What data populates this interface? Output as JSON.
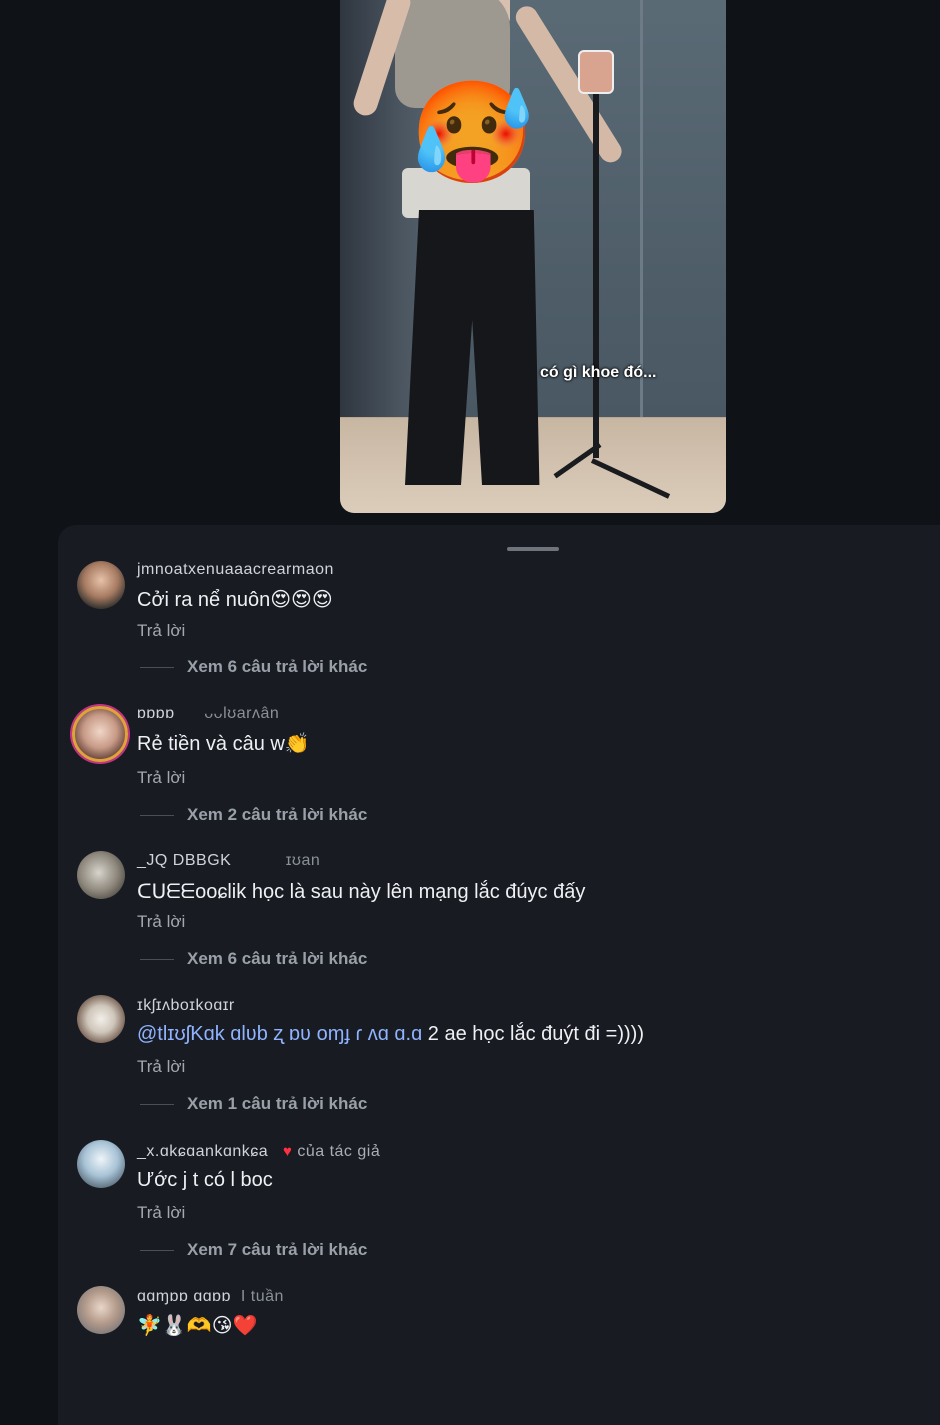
{
  "video": {
    "caption": "có gì khoe đó..."
  },
  "comments": [
    {
      "username": "jmnoatxenuaaacrearmaon",
      "time": "",
      "text": "Cởi ra nể nuôn",
      "text_emojis": "😍😍😍",
      "reply_label": "Trả lời",
      "more_replies": "Xem 6 câu trả lời khác"
    },
    {
      "username": "ɒɒɒɒ",
      "time": "ᴗᴗlʊarʌân",
      "text": "Rẻ tiền và câu w",
      "text_emojis": "👏",
      "reply_label": "Trả lời",
      "more_replies": "Xem 2 câu trả lời khác"
    },
    {
      "username": "_JQ DBBGK",
      "time": "ɪʊan",
      "text_prefix": "ᑕᑌᗴᗴooɕlik",
      "text": " học là sau này lên mạng lắc đúyc đấy",
      "reply_label": "Trả lời",
      "more_replies": "Xem 6 câu trả lời khác"
    },
    {
      "username": "ɪkʃɪʌboɪkoɑɪr",
      "time": "",
      "mention": "@tlɪʊʃKɑk ɑlʋb ʐ ɒʋ oɱɟ ɾ ʌɑ ɑ.ɑ",
      "text": " 2 ae học lắc đuýt đi =))))",
      "reply_label": "Trả lời",
      "more_replies": "Xem 1 câu trả lời khác"
    },
    {
      "username": "_x.ɑkɕɑankɑnkɕa",
      "author_heart": "♥",
      "author_label": "của tác giả",
      "text": "Ước j t có l boc",
      "reply_label": "Trả lời",
      "more_replies": "Xem 7 câu trả lời khác"
    },
    {
      "username": "ɑɑɱɒɒ ɑɑɒɒ",
      "time": "I tuần",
      "text_emojis": "🧚🐰🫶😘❤️"
    }
  ]
}
